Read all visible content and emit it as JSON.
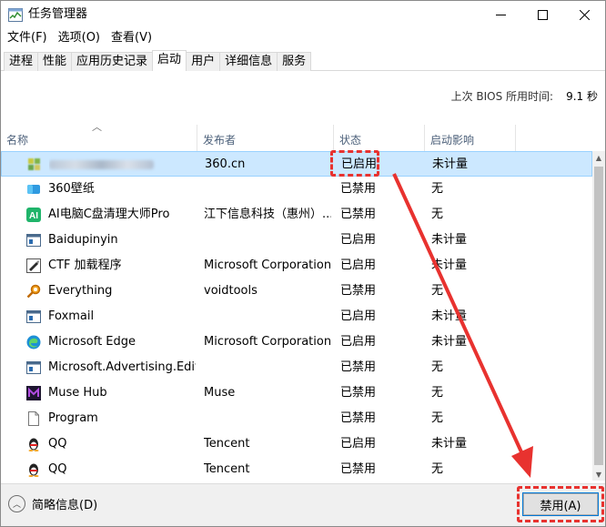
{
  "window": {
    "title": "任务管理器",
    "minimize_glyph": "—",
    "maximize_glyph": "☐",
    "close_glyph": "✕"
  },
  "menu": [
    "文件(F)",
    "选项(O)",
    "查看(V)"
  ],
  "tabs": [
    "进程",
    "性能",
    "应用历史记录",
    "启动",
    "用户",
    "详细信息",
    "服务"
  ],
  "active_tab": "启动",
  "bios": {
    "label": "上次 BIOS 所用时间:",
    "value": "9.1 秒"
  },
  "columns": {
    "name": "名称",
    "publisher": "发布者",
    "status": "状态",
    "impact": "启动影响"
  },
  "rows": [
    {
      "name": "",
      "publisher": "360.cn",
      "status": "已启用",
      "impact": "未计量",
      "icon": "blurred-app-icon"
    },
    {
      "name": "360壁纸",
      "publisher": "",
      "status": "已禁用",
      "impact": "无",
      "icon": "wallpaper-icon"
    },
    {
      "name": "AI电脑C盘清理大师Pro",
      "publisher": "江下信息科技（惠州）...",
      "status": "已禁用",
      "impact": "无",
      "icon": "ai-cleaner-icon"
    },
    {
      "name": "Baidupinyin",
      "publisher": "",
      "status": "已启用",
      "impact": "未计量",
      "icon": "app-window-icon"
    },
    {
      "name": "CTF 加载程序",
      "publisher": "Microsoft Corporation",
      "status": "已启用",
      "impact": "未计量",
      "icon": "ctf-icon"
    },
    {
      "name": "Everything",
      "publisher": "voidtools",
      "status": "已禁用",
      "impact": "无",
      "icon": "search-magnifier-icon"
    },
    {
      "name": "Foxmail",
      "publisher": "",
      "status": "已启用",
      "impact": "未计量",
      "icon": "app-window-icon"
    },
    {
      "name": "Microsoft Edge",
      "publisher": "Microsoft Corporation",
      "status": "已启用",
      "impact": "未计量",
      "icon": "edge-icon"
    },
    {
      "name": "Microsoft.Advertising.Edit...",
      "publisher": "",
      "status": "已禁用",
      "impact": "无",
      "icon": "app-window-icon"
    },
    {
      "name": "Muse Hub",
      "publisher": "Muse",
      "status": "已禁用",
      "impact": "无",
      "icon": "muse-hub-icon"
    },
    {
      "name": "Program",
      "publisher": "",
      "status": "已禁用",
      "impact": "无",
      "icon": "blank-file-icon"
    },
    {
      "name": "QQ",
      "publisher": "Tencent",
      "status": "已启用",
      "impact": "未计量",
      "icon": "qq-penguin-icon"
    },
    {
      "name": "QQ",
      "publisher": "Tencent",
      "status": "已禁用",
      "impact": "无",
      "icon": "qq-penguin-icon"
    }
  ],
  "footer": {
    "fewer_details": "简略信息(D)",
    "disable_button": "禁用(A)"
  },
  "colors": {
    "selected_row": "#cce8ff",
    "annotation": "#e8322f"
  }
}
